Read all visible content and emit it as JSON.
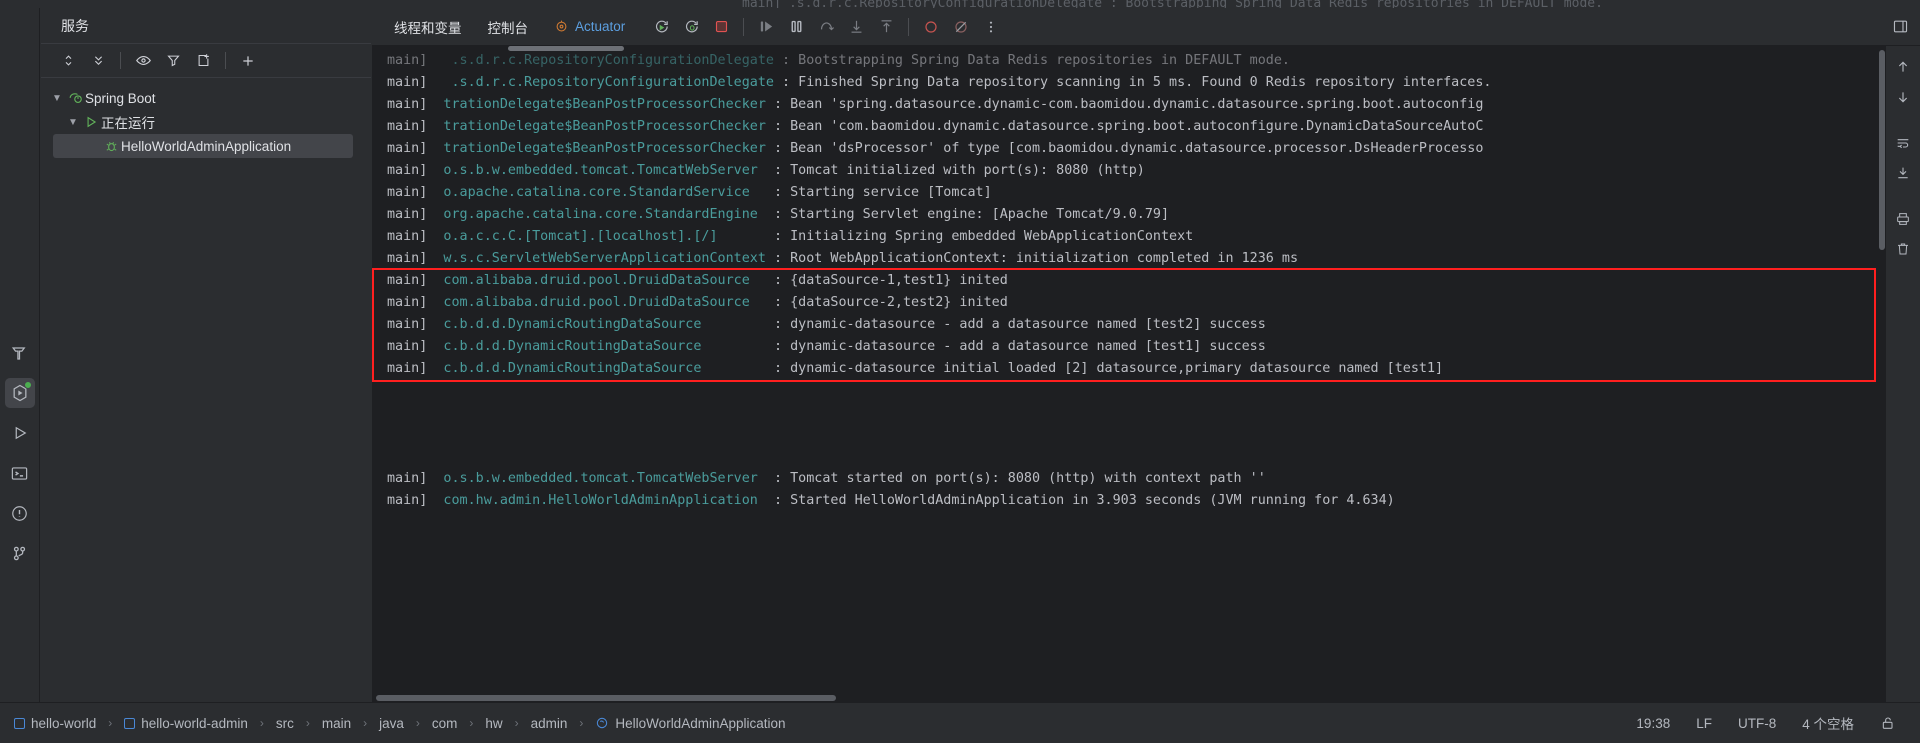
{
  "window": {
    "ghost_top_line": "main]   .s.d.r.c.RepositoryConfigurationDelegate  : Bootstrapping Spring Data Redis repositories in DEFAULT mode."
  },
  "activity_bar": {
    "items": [
      {
        "name": "build-icon",
        "glyph": "hammer"
      },
      {
        "name": "services-icon",
        "glyph": "services",
        "active": true,
        "badge": true
      },
      {
        "name": "run-icon",
        "glyph": "play"
      },
      {
        "name": "terminal-icon",
        "glyph": "terminal"
      },
      {
        "name": "problems-icon",
        "glyph": "warning"
      },
      {
        "name": "version-control-icon",
        "glyph": "branch"
      }
    ]
  },
  "services": {
    "title": "服务",
    "toolbar": [
      {
        "name": "expand-collapse-button",
        "glyph": "updown"
      },
      {
        "name": "collapse-all-button",
        "glyph": "collapse"
      },
      {
        "name": "show-hide-button",
        "glyph": "eye"
      },
      {
        "name": "filter-button",
        "glyph": "filter"
      },
      {
        "name": "add-tab-button",
        "glyph": "newtab"
      },
      {
        "name": "add-service-button",
        "glyph": "plus"
      }
    ],
    "tree": [
      {
        "label": "Spring Boot",
        "level": 0,
        "expanded": true,
        "icon": "spring-boot-icon",
        "selected": false
      },
      {
        "label": "正在运行",
        "level": 1,
        "expanded": true,
        "icon": "run-triangle-icon",
        "selected": false
      },
      {
        "label": "HelloWorldAdminApplication",
        "level": 2,
        "expanded": false,
        "icon": "debug-bug-icon",
        "selected": true
      }
    ]
  },
  "run_panel": {
    "tabs": [
      {
        "label": "线程和变量",
        "name": "tab-threads-variables"
      },
      {
        "label": "控制台",
        "name": "tab-console"
      },
      {
        "label": "Actuator",
        "name": "tab-actuator",
        "accent": true
      }
    ],
    "buttons": [
      {
        "name": "rerun-button",
        "glyph": "rerun"
      },
      {
        "name": "rerun-debug-button",
        "glyph": "rerun-debug"
      },
      {
        "name": "stop-button",
        "glyph": "stop"
      },
      {
        "name": "resume-program-button",
        "glyph": "resume"
      },
      {
        "name": "pause-program-button",
        "glyph": "pause"
      },
      {
        "name": "step-over-button",
        "glyph": "step-over"
      },
      {
        "name": "step-into-button",
        "glyph": "step-into"
      },
      {
        "name": "step-out-button",
        "glyph": "step-out"
      },
      {
        "name": "mute-breakpoints-button",
        "glyph": "mute-breakpoints"
      },
      {
        "name": "view-breakpoints-button",
        "glyph": "view-breakpoints"
      },
      {
        "name": "more-options-button",
        "glyph": "kebab"
      }
    ],
    "right_buttons": [
      {
        "name": "layout-settings-button",
        "glyph": "layout"
      }
    ],
    "gutter_buttons": [
      {
        "name": "scroll-up-button",
        "glyph": "arrow-up"
      },
      {
        "name": "scroll-down-button",
        "glyph": "arrow-down"
      },
      {
        "name": "soft-wrap-button",
        "glyph": "wrap"
      },
      {
        "name": "scroll-to-end-button",
        "glyph": "scroll-end"
      },
      {
        "name": "print-button",
        "glyph": "print"
      },
      {
        "name": "clear-all-button",
        "glyph": "trash"
      }
    ]
  },
  "console": {
    "highlight_color": "#ff1f1f",
    "lines": [
      {
        "thread": "main]",
        "logger": "  .s.d.r.c.RepositoryConfigurationDelegate",
        "message": ": Bootstrapping Spring Data Redis repositories in DEFAULT mode.",
        "partial_top": true
      },
      {
        "thread": "main]",
        "logger": "  .s.d.r.c.RepositoryConfigurationDelegate",
        "message": ": Finished Spring Data repository scanning in 5 ms. Found 0 Redis repository interfaces."
      },
      {
        "thread": "main]",
        "logger": " trationDelegate$BeanPostProcessorChecker",
        "message": ": Bean 'spring.datasource.dynamic-com.baomidou.dynamic.datasource.spring.boot.autoconfig"
      },
      {
        "thread": "main]",
        "logger": " trationDelegate$BeanPostProcessorChecker",
        "message": ": Bean 'com.baomidou.dynamic.datasource.spring.boot.autoconfigure.DynamicDataSourceAutoC"
      },
      {
        "thread": "main]",
        "logger": " trationDelegate$BeanPostProcessorChecker",
        "message": ": Bean 'dsProcessor' of type [com.baomidou.dynamic.datasource.processor.DsHeaderProcesso"
      },
      {
        "thread": "main]",
        "logger": " o.s.b.w.embedded.tomcat.TomcatWebServer ",
        "message": ": Tomcat initialized with port(s): 8080 (http)"
      },
      {
        "thread": "main]",
        "logger": " o.apache.catalina.core.StandardService  ",
        "message": ": Starting service [Tomcat]"
      },
      {
        "thread": "main]",
        "logger": " org.apache.catalina.core.StandardEngine ",
        "message": ": Starting Servlet engine: [Apache Tomcat/9.0.79]"
      },
      {
        "thread": "main]",
        "logger": " o.a.c.c.C.[Tomcat].[localhost].[/]      ",
        "message": ": Initializing Spring embedded WebApplicationContext"
      },
      {
        "thread": "main]",
        "logger": " w.s.c.ServletWebServerApplicationContext",
        "message": ": Root WebApplicationContext: initialization completed in 1236 ms"
      },
      {
        "thread": "main]",
        "logger": " com.alibaba.druid.pool.DruidDataSource  ",
        "message": ": {dataSource-1,test1} inited",
        "highlighted": true
      },
      {
        "thread": "main]",
        "logger": " com.alibaba.druid.pool.DruidDataSource  ",
        "message": ": {dataSource-2,test2} inited",
        "highlighted": true
      },
      {
        "thread": "main]",
        "logger": " c.b.d.d.DynamicRoutingDataSource        ",
        "message": ": dynamic-datasource - add a datasource named [test2] success",
        "highlighted": true
      },
      {
        "thread": "main]",
        "logger": " c.b.d.d.DynamicRoutingDataSource        ",
        "message": ": dynamic-datasource - add a datasource named [test1] success",
        "highlighted": true
      },
      {
        "thread": "main]",
        "logger": " c.b.d.d.DynamicRoutingDataSource        ",
        "message": ": dynamic-datasource initial loaded [2] datasource,primary datasource named [test1]",
        "highlighted": true
      },
      {
        "blank": true
      },
      {
        "blank": true
      },
      {
        "blank": true
      },
      {
        "blank": true
      },
      {
        "thread": "main]",
        "logger": " o.s.b.w.embedded.tomcat.TomcatWebServer ",
        "message": ": Tomcat started on port(s): 8080 (http) with context path ''"
      },
      {
        "thread": "main]",
        "logger": " com.hw.admin.HelloWorldAdminApplication ",
        "message": ": Started HelloWorldAdminApplication in 3.903 seconds (JVM running for 4.634)"
      }
    ]
  },
  "status_bar": {
    "breadcrumbs": [
      {
        "label": "hello-world",
        "icon": "module-icon"
      },
      {
        "label": "hello-world-admin",
        "icon": "module-icon"
      },
      {
        "label": "src",
        "icon": null
      },
      {
        "label": "main",
        "icon": null
      },
      {
        "label": "java",
        "icon": null
      },
      {
        "label": "com",
        "icon": null
      },
      {
        "label": "hw",
        "icon": null
      },
      {
        "label": "admin",
        "icon": null
      },
      {
        "label": "HelloWorldAdminApplication",
        "icon": "spring-class-icon"
      }
    ],
    "separator": "›",
    "right": [
      {
        "name": "cursor-position",
        "label": "19:38"
      },
      {
        "name": "line-separator",
        "label": "LF"
      },
      {
        "name": "file-encoding",
        "label": "UTF-8"
      },
      {
        "name": "indent-setting",
        "label": "4 个空格"
      }
    ],
    "lock_icon": "unlocked-icon"
  }
}
